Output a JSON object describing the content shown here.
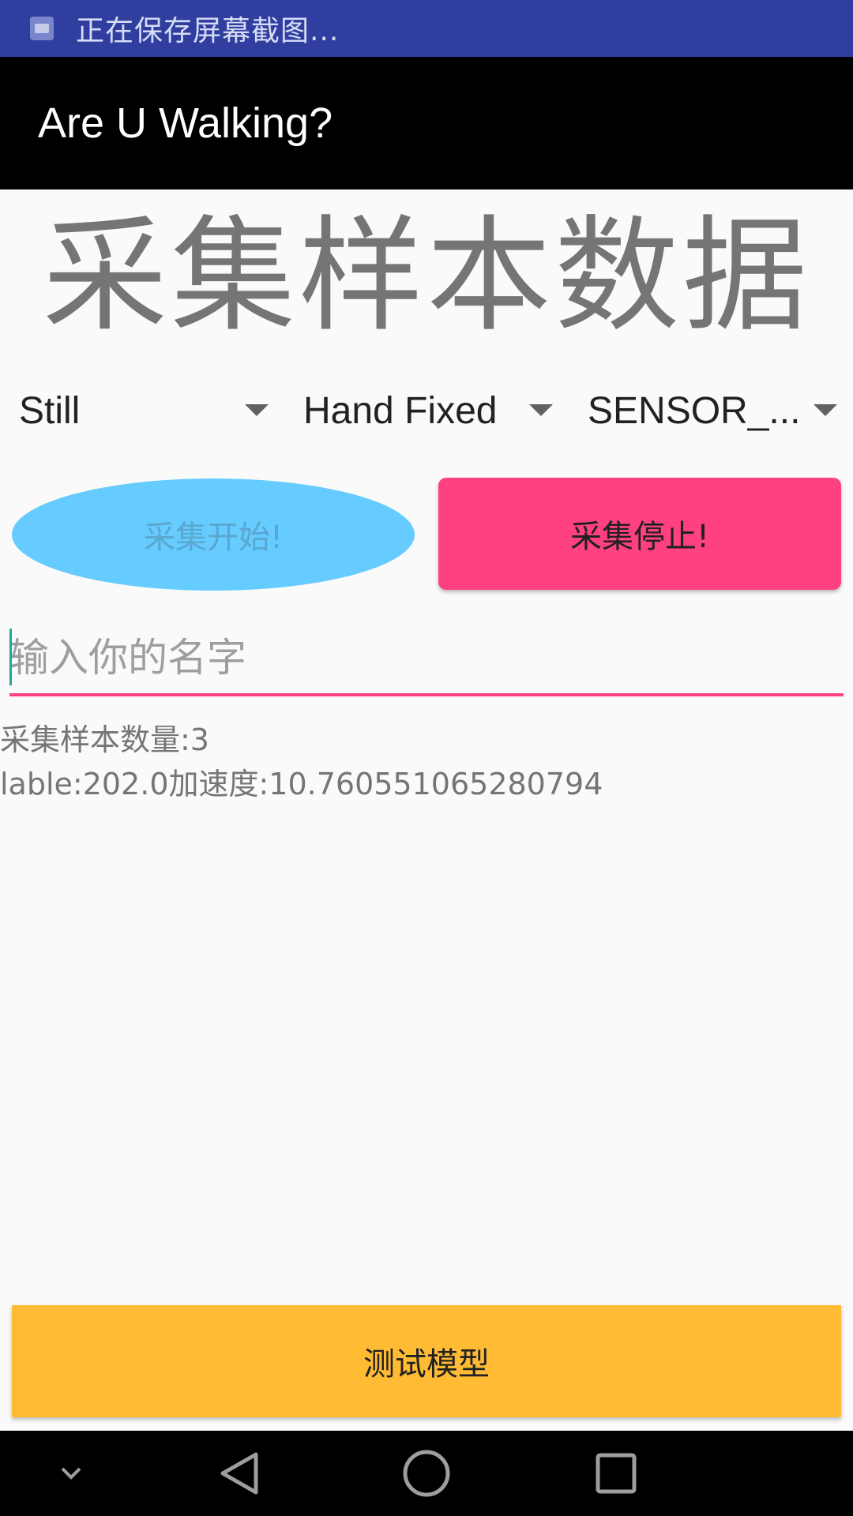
{
  "status_bar": {
    "notification_icon": "image-icon",
    "notification_text": "正在保存屏幕截图..."
  },
  "app_bar": {
    "title": "Are U Walking?"
  },
  "heading": "采集样本数据",
  "spinners": [
    {
      "value": "Still"
    },
    {
      "value": "Hand Fixed"
    },
    {
      "value": "SENSOR_..."
    }
  ],
  "buttons": {
    "start": "采集开始!",
    "stop": "采集停止!",
    "test_model": "测试模型"
  },
  "name_input": {
    "placeholder": "输入你的名字",
    "value": ""
  },
  "info": {
    "sample_count": "采集样本数量:3",
    "label_accel": "lable:202.0加速度:10.760551065280794"
  },
  "nav_bar": {
    "icons": [
      "chevron-down-icon",
      "back-icon",
      "home-icon",
      "recents-icon"
    ]
  },
  "colors": {
    "status_bar": "#303f9f",
    "app_bar": "#000000",
    "start_button": "#66ccff",
    "stop_button": "#ff4081",
    "test_button": "#ffbb33",
    "input_underline": "#ff4081"
  }
}
